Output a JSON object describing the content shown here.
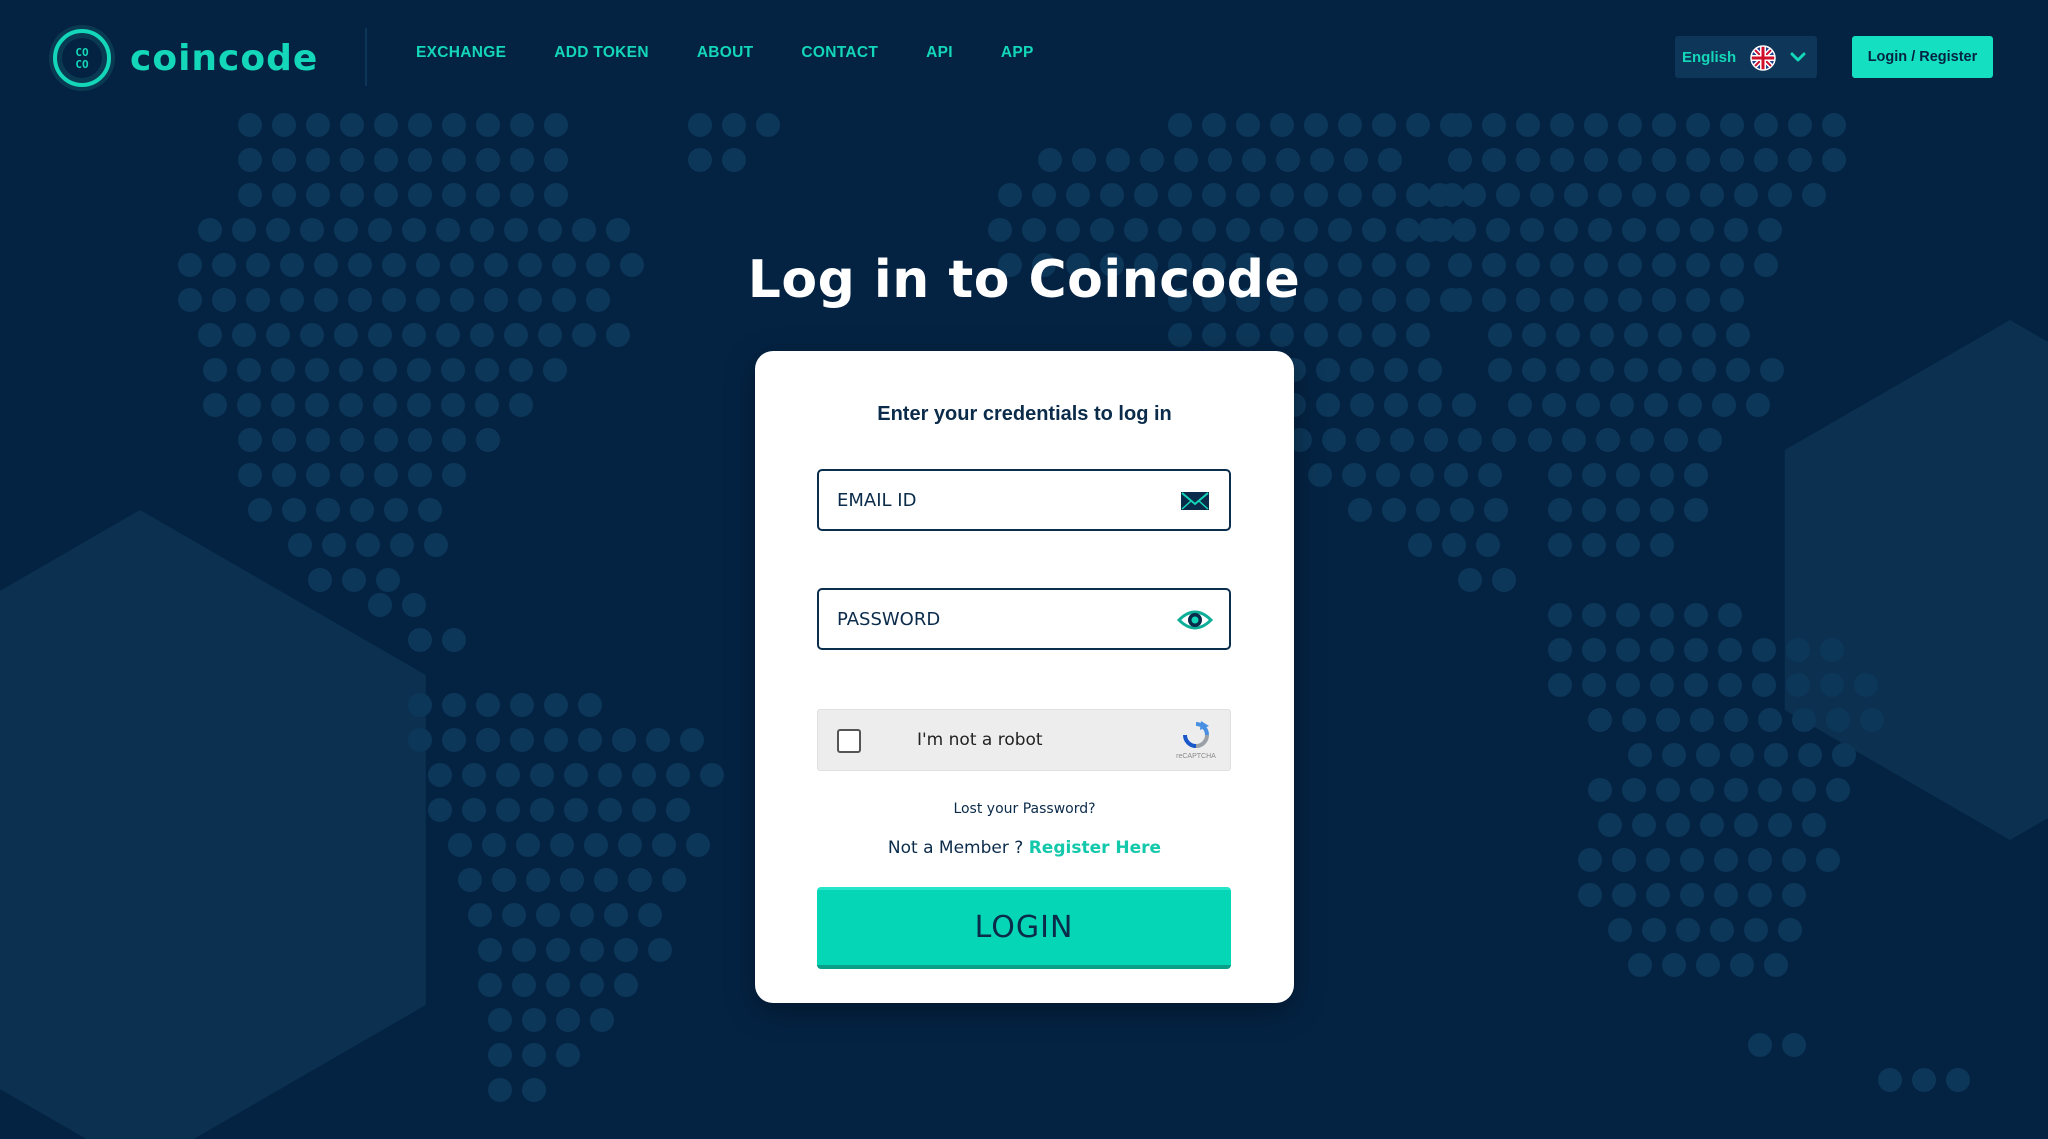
{
  "brand": {
    "name": "coincode",
    "logo_mark": "CO CO"
  },
  "nav": {
    "items": [
      {
        "label": "EXCHANGE"
      },
      {
        "label": "ADD TOKEN"
      },
      {
        "label": "ABOUT"
      },
      {
        "label": "CONTACT"
      },
      {
        "label": "API"
      },
      {
        "label": "APP"
      }
    ]
  },
  "header": {
    "language": {
      "label": "English",
      "flag_icon": "uk-flag-icon",
      "dropdown_icon": "chevron-down-icon"
    },
    "login_register": "Login / Register"
  },
  "page": {
    "title": "Log in to Coincode"
  },
  "form": {
    "subtitle": "Enter your credentials to log in",
    "email": {
      "placeholder": "EMAIL ID",
      "icon": "envelope-icon"
    },
    "password": {
      "placeholder": "PASSWORD",
      "icon": "eye-icon"
    },
    "captcha": {
      "label": "I'm not a robot",
      "brand": "reCAPTCHA"
    },
    "lost_password": "Lost your Password?",
    "not_member": "Not a Member ?",
    "register_link": "Register Here",
    "submit": "LOGIN"
  },
  "colors": {
    "background": "#042343",
    "accent": "#14d7b9",
    "button": "#05d6b6",
    "text_dark": "#0b2b4a"
  }
}
